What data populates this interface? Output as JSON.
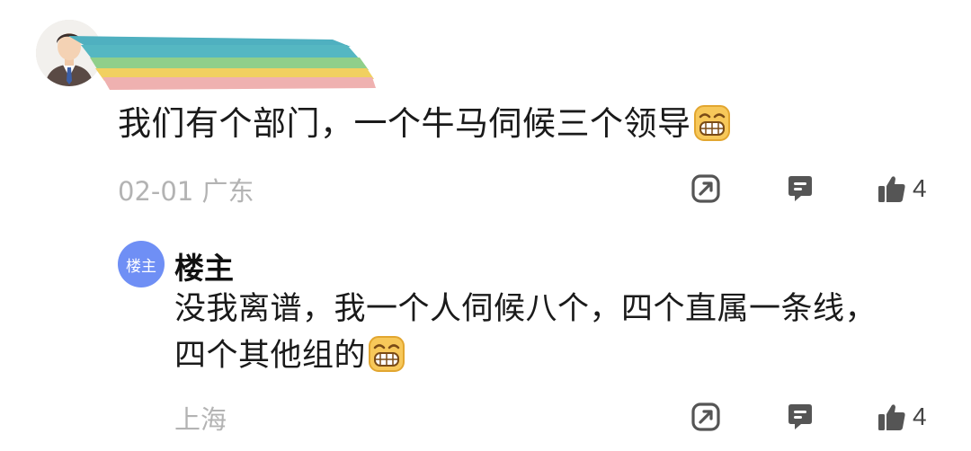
{
  "comment": {
    "text": "我们有个部门，一个牛马伺候三个领导",
    "date": "02-01",
    "location": "广东",
    "likes": "4",
    "emoji": "grin-emoji"
  },
  "reply": {
    "badge": "楼主",
    "author": "楼主",
    "line1": "没我离谱，我一个人伺候八个，四个直属一条线，",
    "line2": "四个其他组的",
    "location": "上海",
    "likes": "4",
    "emoji": "grin-emoji"
  },
  "icons": {
    "share": "share-icon",
    "comment": "comment-icon",
    "like": "thumbs-up-icon"
  },
  "colors": {
    "badge_bg": "#6f8ff5",
    "meta_text": "#b3b3b3",
    "icon": "#555555"
  }
}
